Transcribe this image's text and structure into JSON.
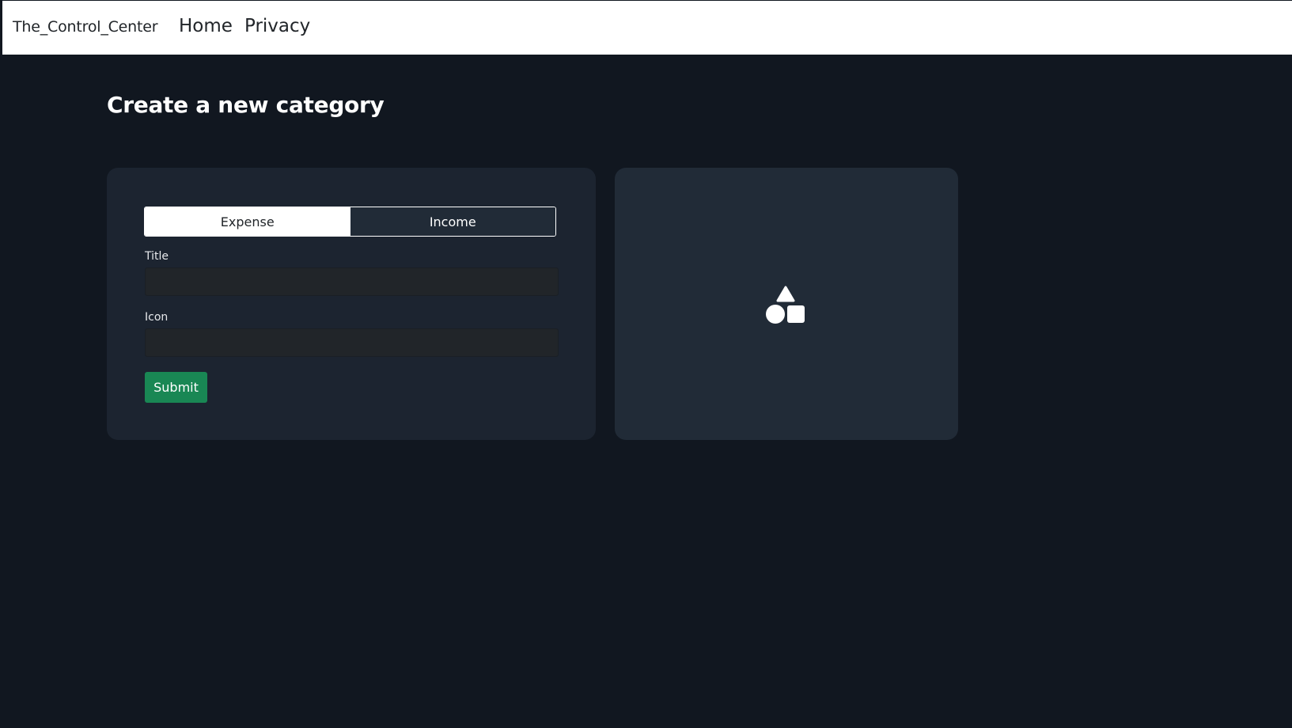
{
  "navbar": {
    "brand": "The_Control_Center",
    "links": [
      {
        "label": "Home"
      },
      {
        "label": "Privacy"
      }
    ]
  },
  "page": {
    "title": "Create a new category"
  },
  "form": {
    "type_toggle": {
      "options": [
        {
          "label": "Expense",
          "selected": true
        },
        {
          "label": "Income",
          "selected": false
        }
      ]
    },
    "title_field": {
      "label": "Title",
      "value": "",
      "placeholder": ""
    },
    "icon_field": {
      "label": "Icon",
      "value": "",
      "placeholder": ""
    },
    "submit_label": "Submit"
  },
  "preview": {
    "icon": "shapes-icon"
  },
  "colors": {
    "background": "#111720",
    "card": "#1c2430",
    "preview_card": "#212b37",
    "submit": "#198754",
    "navbar": "#ffffff"
  }
}
